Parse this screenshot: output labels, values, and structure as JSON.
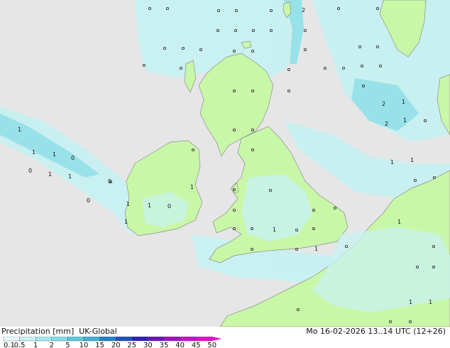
{
  "footer": {
    "title_left": "Precipitation [mm]  UK-Global",
    "title_right": "Mo 16-02-2026 13..14 UTC (12+26)"
  },
  "scale": {
    "labels": [
      "0.1",
      "0.5",
      "1",
      "2",
      "5",
      "10",
      "15",
      "20",
      "25",
      "30",
      "35",
      "40",
      "45",
      "50"
    ],
    "colors": [
      "#e6fbfb",
      "#c6f2f4",
      "#a4e9ef",
      "#83dde9",
      "#5ec8de",
      "#3db2d4",
      "#2580c8",
      "#1f4fc4",
      "#2f1ec4",
      "#6b12c7",
      "#a00fca",
      "#d00ccc",
      "#f00ac8"
    ]
  },
  "map": {
    "colors": {
      "sea": "#e6e6e6",
      "land": "#c9f7a8",
      "precip_light": "#c8f1f2",
      "precip_medium": "#94e1ea",
      "coast": "#8c8c8c"
    },
    "point_labels": [
      "1",
      "1",
      "1",
      "0",
      "0",
      "1",
      "1",
      "0",
      "1",
      "1",
      "2",
      "2",
      "1",
      "2",
      "1",
      "1",
      "1",
      "1",
      "0",
      "0",
      "1",
      "1",
      "1",
      "1",
      "1",
      "1"
    ]
  }
}
